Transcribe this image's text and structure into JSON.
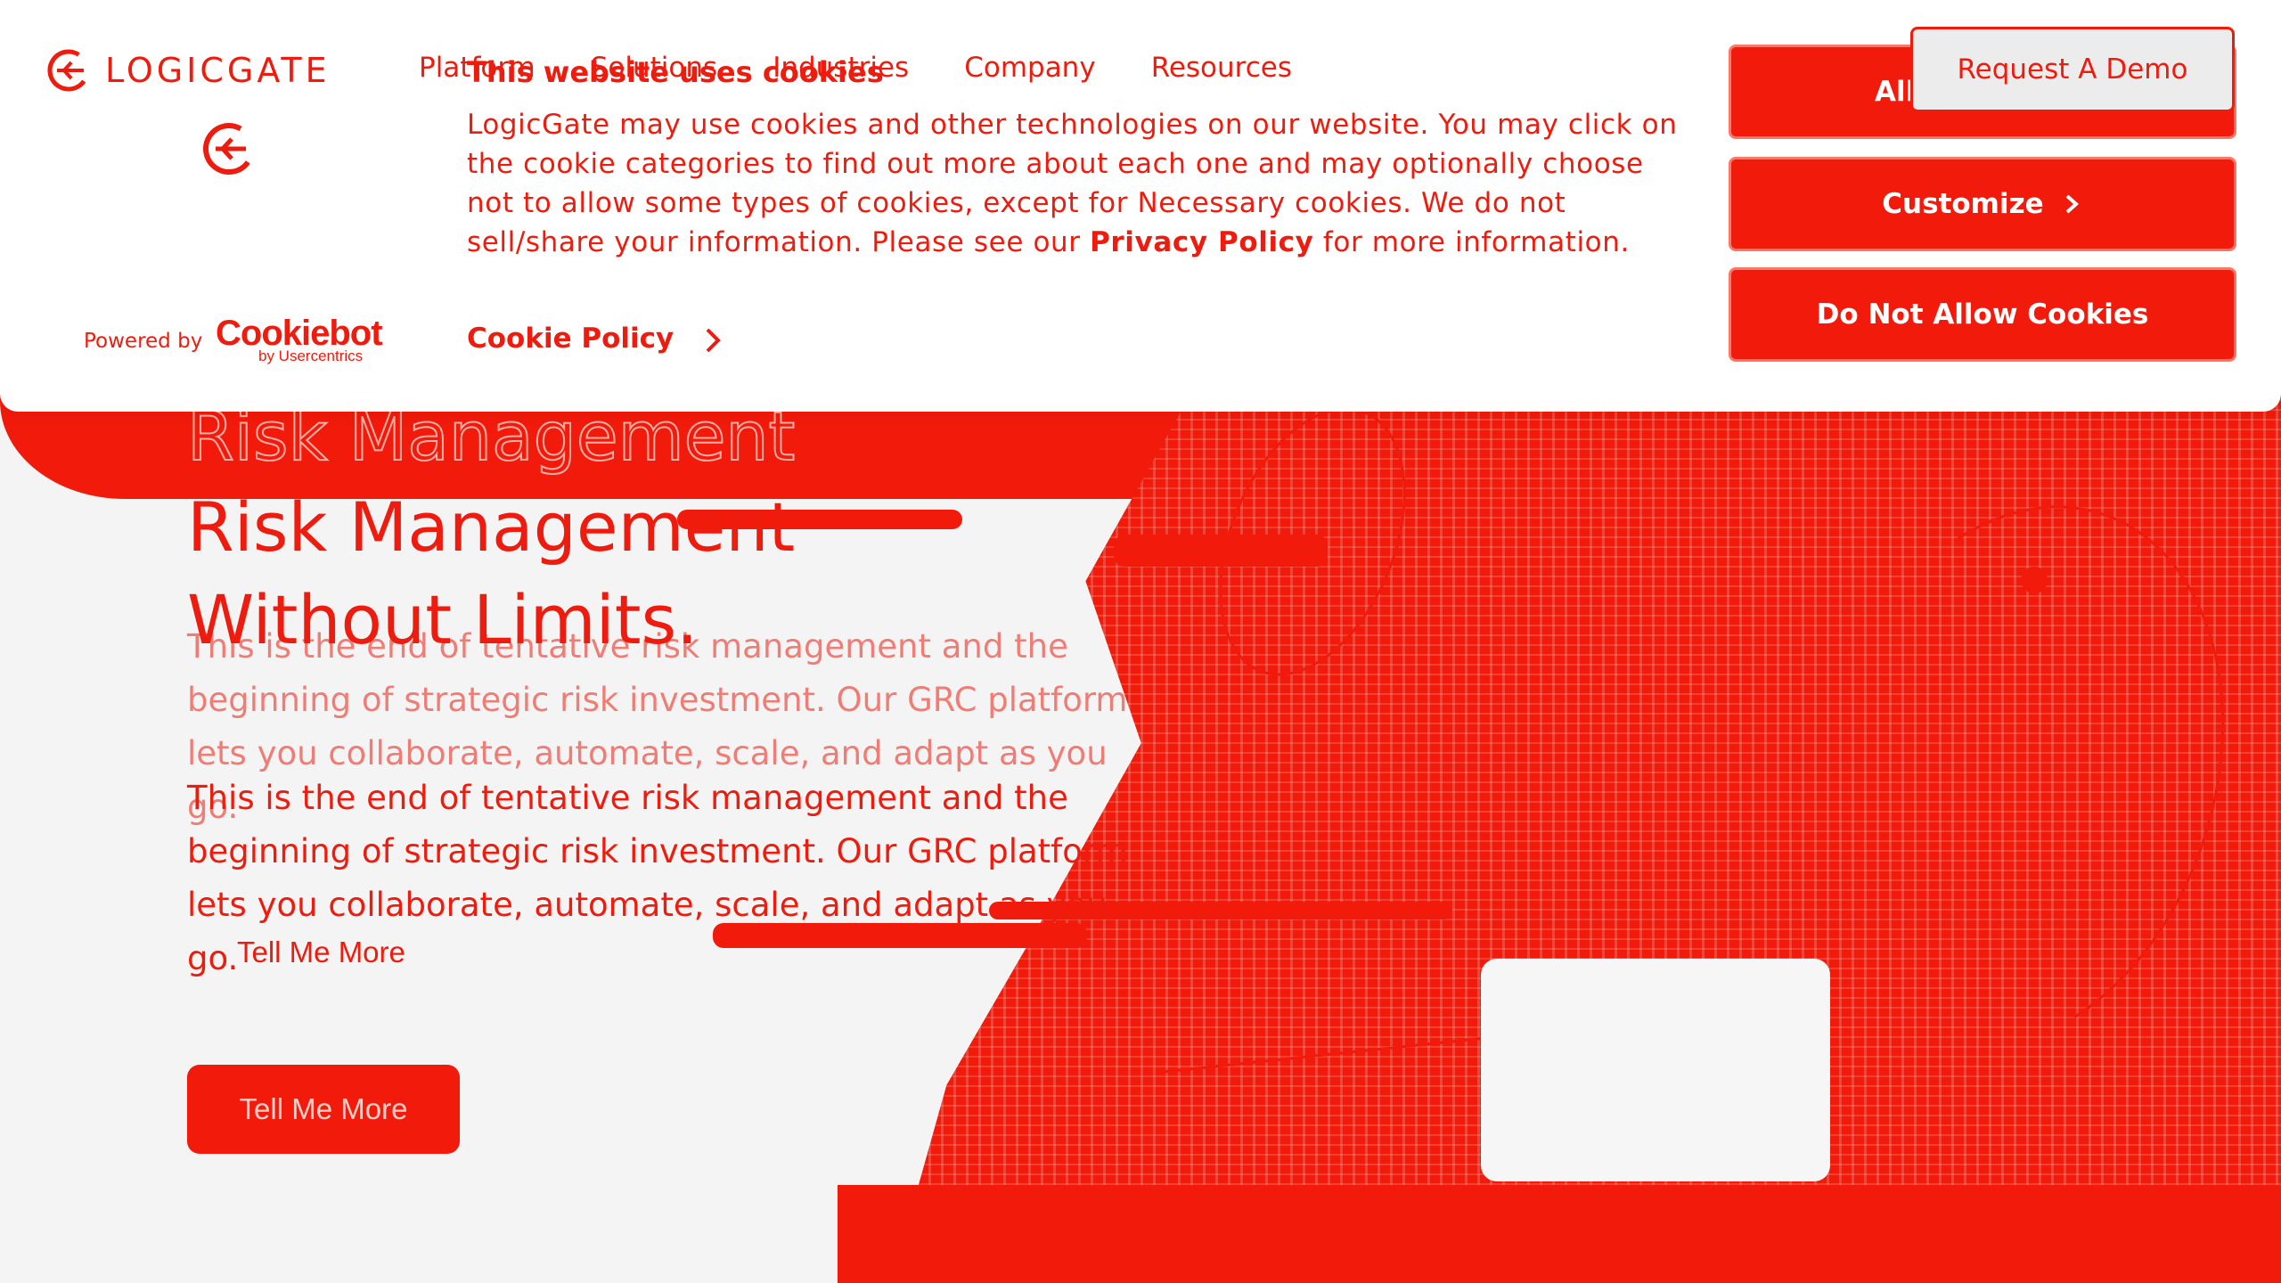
{
  "nav": {
    "logo_text": "LOGICGATE",
    "items": [
      "Platform",
      "Solutions",
      "Industries",
      "Company",
      "Resources"
    ],
    "demo_label": "Request A Demo"
  },
  "cookie_banner": {
    "heading": "This website uses cookies",
    "body_pre": "LogicGate may use cookies and other technologies on our website. You may click on the cookie categories to find out more about each one and may optionally choose not to allow some types of cookies, except for Necessary cookies.  We do not sell/share your information. Please see our ",
    "privacy_link": "Privacy Policy",
    "body_post": " for more information.",
    "policy_link": "Cookie Policy",
    "powered_by": "Powered by",
    "cookiebot_brand": "Cookiebot",
    "cookiebot_sub": "by Usercentrics",
    "allow_label": "Allow Cookies",
    "customize_label": "Customize",
    "deny_label": "Do Not Allow Cookies"
  },
  "hero": {
    "title_line1": "Risk Management",
    "title_line2": "Without Limits.",
    "description": "This is the end of tentative risk management and the beginning of strategic risk investment. Our GRC platform lets you collaborate, automate, scale, and adapt as you go.",
    "cta_label": "Tell Me More"
  },
  "colors": {
    "accent": "#f21a0b",
    "background": "#f4f4f4",
    "banner": "#ffffff"
  },
  "icons": {
    "brand": "logicgate-logo-icon",
    "chevron": "chevron-right-icon"
  }
}
